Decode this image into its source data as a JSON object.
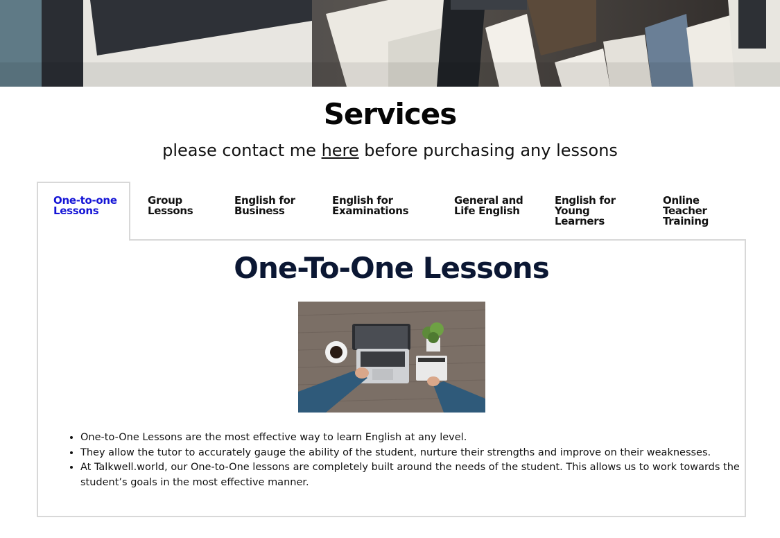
{
  "header": {
    "title": "Services",
    "subtitle_before": "please contact me ",
    "subtitle_link": "here",
    "subtitle_after": " before purchasing any lessons"
  },
  "tabs": [
    {
      "line1": "One-to-one",
      "line2": "Lessons",
      "line3": "",
      "active": true
    },
    {
      "line1": "Group",
      "line2": "Lessons",
      "line3": "",
      "active": false
    },
    {
      "line1": "English for",
      "line2": "Business",
      "line3": "",
      "active": false
    },
    {
      "line1": "English for",
      "line2": "Examinations",
      "line3": "",
      "active": false
    },
    {
      "line1": "General and",
      "line2": "Life English",
      "line3": "",
      "active": false
    },
    {
      "line1": "English for",
      "line2": "Young",
      "line3": "Learners",
      "active": false
    },
    {
      "line1": "Online",
      "line2": "Teacher",
      "line3": "Training",
      "active": false
    }
  ],
  "panel": {
    "title": "One-To-One Lessons",
    "bullets": [
      "One-to-One Lessons are the most effective way to learn English at any level.",
      "They allow the tutor to accurately gauge the ability of the student, nurture their strengths and improve on their weaknesses.",
      "At Talkwell.world, our One-to-One lessons are completely built around the needs of the student. This allows us to work towards the student’s goals in the most effective manner."
    ]
  },
  "colors": {
    "active_tab": "#1515d6",
    "section_title": "#0b1733",
    "border": "#d8d8d8"
  }
}
